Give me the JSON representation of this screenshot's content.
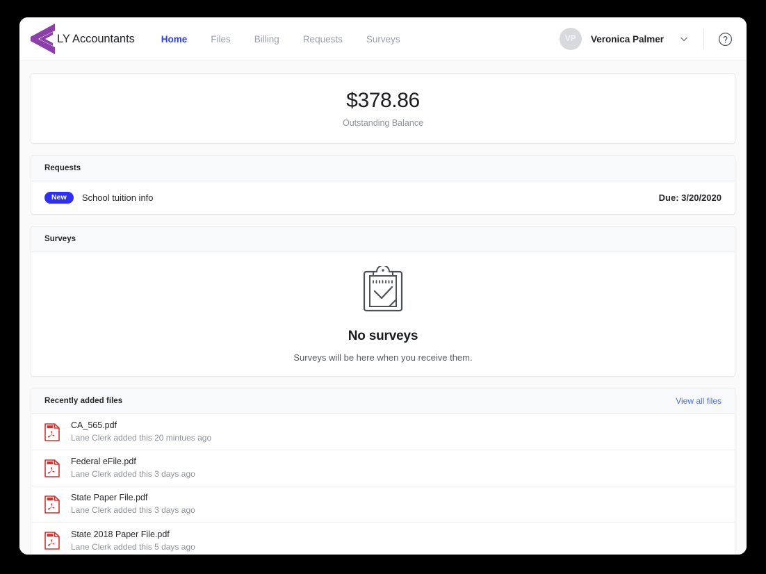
{
  "header": {
    "brand_name": "LY Accountants",
    "logo_icon": "chevron-left-logo",
    "nav": [
      {
        "label": "Home",
        "active": true
      },
      {
        "label": "Files",
        "active": false
      },
      {
        "label": "Billing",
        "active": false
      },
      {
        "label": "Requests",
        "active": false
      },
      {
        "label": "Surveys",
        "active": false
      }
    ],
    "user": {
      "initials": "VP",
      "name": "Veronica Palmer",
      "dropdown_icon": "chevron-down-icon"
    },
    "help_icon": "question-circle-icon"
  },
  "balance": {
    "amount": "$378.86",
    "label": "Outstanding Balance"
  },
  "requests": {
    "title": "Requests",
    "items": [
      {
        "badge": "New",
        "title": "School tuition info",
        "due": "Due: 3/20/2020"
      }
    ]
  },
  "surveys": {
    "title": "Surveys",
    "empty_icon": "clipboard-check-icon",
    "empty_title": "No surveys",
    "empty_subtitle": "Surveys will be here when you receive them."
  },
  "files": {
    "title": "Recently added files",
    "view_all_label": "View all files",
    "items": [
      {
        "icon": "pdf-file-icon",
        "name": "CA_565.pdf",
        "meta": "Lane Clerk added this 20 mintues ago"
      },
      {
        "icon": "pdf-file-icon",
        "name": "Federal eFile.pdf",
        "meta": "Lane Clerk added this 3 days ago"
      },
      {
        "icon": "pdf-file-icon",
        "name": "State Paper File.pdf",
        "meta": "Lane Clerk added this 3 days ago"
      },
      {
        "icon": "pdf-file-icon",
        "name": "State 2018 Paper File.pdf",
        "meta": "Lane Clerk added this 5 days ago"
      }
    ]
  },
  "colors": {
    "brand_purple": "#8c3fa8",
    "accent_blue": "#2f3ef5",
    "badge_blue": "#2f2ff0",
    "link_blue": "#4a6fe0",
    "pdf_red": "#cf3330",
    "page_bg": "#fafafa"
  }
}
